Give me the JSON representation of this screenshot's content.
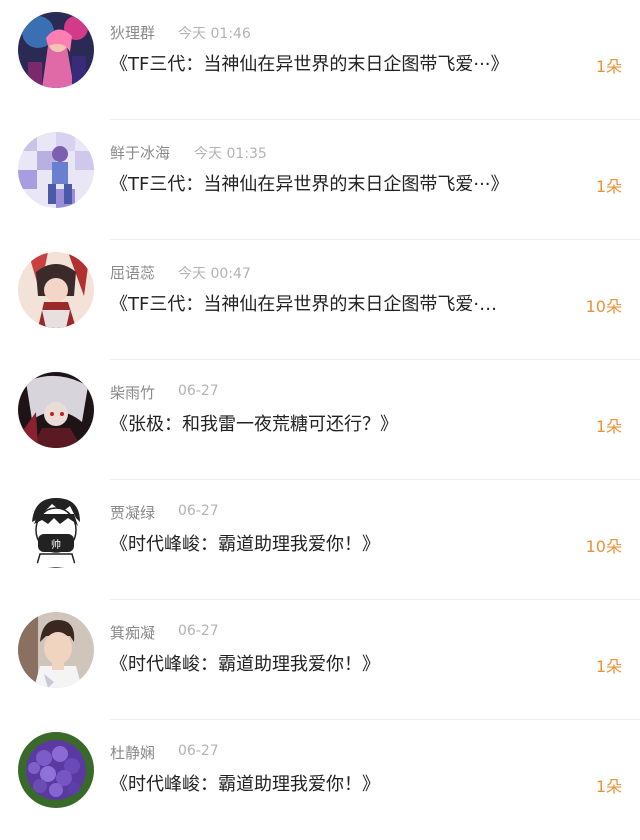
{
  "items": [
    {
      "name": "狄理群",
      "time": "今天 01:46",
      "title": "《TF三代：当神仙在异世界的末日企图带飞爱···》",
      "count": "1朵",
      "avatar_icon": "avatar-anime-girl-pink-hair"
    },
    {
      "name": "鲜于冰海",
      "time": "今天 01:35",
      "title": "《TF三代：当神仙在异世界的末日企图带飞爱···》",
      "count": "1朵",
      "avatar_icon": "avatar-pixelated-dancer"
    },
    {
      "name": "屈语蕊",
      "time": "今天 00:47",
      "title": "《TF三代：当神仙在异世界的末日企图带飞爱·…",
      "count": "10朵",
      "avatar_icon": "avatar-anime-boy-red"
    },
    {
      "name": "柴雨竹",
      "time": "06-27",
      "title": "《张极：和我雷一夜荒糖可还行？》",
      "count": "1朵",
      "avatar_icon": "avatar-anime-dark-white-hair"
    },
    {
      "name": "贾凝绿",
      "time": "06-27",
      "title": "《时代峰峻：霸道助理我爱你！》",
      "count": "10朵",
      "avatar_icon": "avatar-cartoon-boy-mask"
    },
    {
      "name": "箕痴凝",
      "time": "06-27",
      "title": "《时代峰峻：霸道助理我爱你！》",
      "count": "1朵",
      "avatar_icon": "avatar-photo-boy"
    },
    {
      "name": "杜静娴",
      "time": "06-27",
      "title": "《时代峰峻：霸道助理我爱你！》",
      "count": "1朵",
      "avatar_icon": "avatar-purple-hydrangea"
    }
  ],
  "colors": {
    "name": "#8a8a8a",
    "time": "#b3b3b3",
    "title": "#222222",
    "count": "#e8923a",
    "divider": "#efefef"
  }
}
